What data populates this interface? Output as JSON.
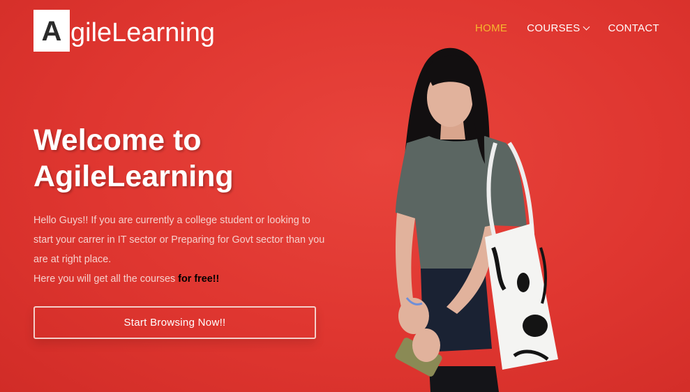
{
  "brand": {
    "logo_letter": "A",
    "logo_text": "gileLearning"
  },
  "nav": {
    "items": [
      {
        "label": "HOME",
        "active": true
      },
      {
        "label": "COURSES",
        "dropdown": true
      },
      {
        "label": "CONTACT"
      }
    ]
  },
  "hero": {
    "title_line1": "Welcome to",
    "title_line2": "AgileLearning",
    "desc_line1": "Hello Guys!! If you are currently a college student or looking to start your carrer in IT sector or Preparing for Govt sector than you are at right place.",
    "desc_line2": "Here you will get all the courses ",
    "desc_highlight": "for free!!",
    "cta_label": "Start Browsing Now!!"
  },
  "colors": {
    "background": "#e23a33",
    "nav_active": "#f5b82e",
    "text": "#ffffff"
  }
}
